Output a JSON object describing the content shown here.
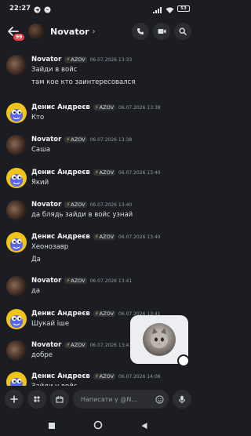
{
  "status_bar": {
    "time": "22:27",
    "battery": "53",
    "icons": [
      "telegram-icon",
      "messenger-icon",
      "signal-icon",
      "wifi-icon",
      "battery-icon"
    ]
  },
  "header": {
    "title": "Novator",
    "chevron": "›",
    "unread_badge": "99",
    "actions": [
      "phone-icon",
      "video-icon",
      "search-icon"
    ]
  },
  "messages": [
    {
      "author": "Novator",
      "tag": "AZOV",
      "time": "06.07.2026 13:33",
      "lines": [
        "Зайди в войс",
        "там кое кто заинтересовался"
      ],
      "avatar": "novator"
    },
    {
      "author": "Денис Андреєв",
      "tag": "AZOV",
      "time": "06.07.2026 13:38",
      "lines": [
        "Кто"
      ],
      "avatar": "denis"
    },
    {
      "author": "Novator",
      "tag": "AZOV",
      "time": "06.07.2026 13:38",
      "lines": [
        "Саша"
      ],
      "avatar": "novator"
    },
    {
      "author": "Денис Андреєв",
      "tag": "AZOV",
      "time": "06.07.2026 13:40",
      "lines": [
        "Який"
      ],
      "avatar": "denis"
    },
    {
      "author": "Novator",
      "tag": "AZOV",
      "time": "06.07.2026 13:40",
      "lines": [
        "да блядь зайди в войс узнай"
      ],
      "avatar": "novator"
    },
    {
      "author": "Денис Андреєв",
      "tag": "AZOV",
      "time": "06.07.2026 13:40",
      "lines": [
        "Хеонозавр",
        "Да"
      ],
      "avatar": "denis"
    },
    {
      "author": "Novator",
      "tag": "AZOV",
      "time": "06.07.2026 13:41",
      "lines": [
        "да"
      ],
      "avatar": "novator"
    },
    {
      "author": "Денис Андреєв",
      "tag": "AZOV",
      "time": "06.07.2026 13:41",
      "lines": [
        "Шукай іше"
      ],
      "avatar": "denis"
    },
    {
      "author": "Novator",
      "tag": "AZOV",
      "time": "06.07.2026 13:41",
      "lines": [
        "добре"
      ],
      "avatar": "novator"
    },
    {
      "author": "Денис Андреєв",
      "tag": "AZOV",
      "time": "06.07.2026 14:08",
      "lines": [
        "Зайди у войс"
      ],
      "avatar": "denis"
    }
  ],
  "input": {
    "placeholder": "Написати у @N..."
  },
  "colors": {
    "background": "#1c1d22",
    "badge": "#f23f43",
    "tag_bolt": "#f0b232"
  }
}
